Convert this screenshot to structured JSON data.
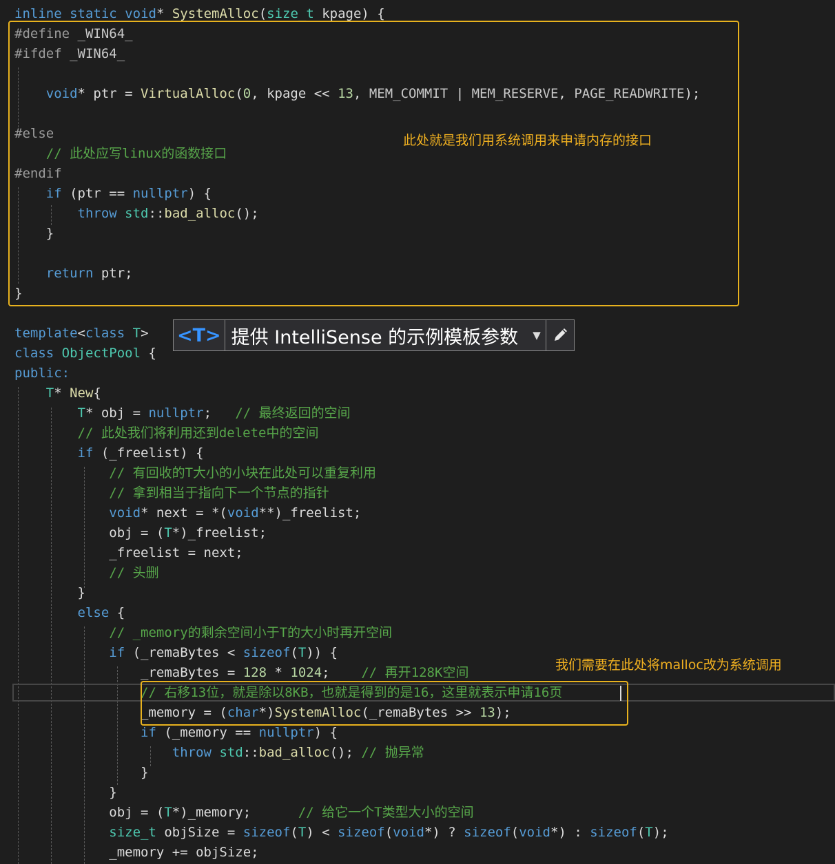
{
  "code": {
    "l1": "inline static void* SystemAlloc(size_t kpage) {",
    "l2": "#define _WIN64_",
    "l3": "#ifdef _WIN64_",
    "l4": "    void* ptr = VirtualAlloc(0, kpage << 13, MEM_COMMIT | MEM_RESERVE, PAGE_READWRITE);",
    "l5": "#else",
    "l6": "    // 此处应写linux的函数接口",
    "l7": "#endif",
    "l8": "    if (ptr == nullptr) {",
    "l9": "        throw std::bad_alloc();",
    "l10": "    }",
    "l11": "    return ptr;",
    "l12": "}",
    "l13": "template<class T>",
    "l14": "class ObjectPool {",
    "l15": "public:",
    "l16": "    T* New{",
    "l17": "        T* obj = nullptr;   // 最终返回的空间",
    "l18": "        // 此处我们将利用还到delete中的空间",
    "l19": "        if (_freelist) {",
    "l20": "            // 有回收的T大小的小块在此处可以重复利用",
    "l21": "            // 拿到相当于指向下一个节点的指针",
    "l22": "            void* next = *(void**)_freelist;",
    "l23": "            obj = (T*)_freelist;",
    "l24": "            _freelist = next;",
    "l25": "            // 头删",
    "l26": "        }",
    "l27": "        else {",
    "l28": "            // _memory的剩余空间小于T的大小时再开空间",
    "l29": "            if (_remaBytes < sizeof(T)) {",
    "l30": "                _remaBytes = 128 * 1024;    // 再开128K空间",
    "l31": "                // 右移13位，就是除以8KB，也就是得到的是16，这里就表示申请16页",
    "l32": "                _memory = (char*)SystemAlloc(_remaBytes >> 13);",
    "l33": "                if (_memory == nullptr) {",
    "l34": "                    throw std::bad_alloc(); // 抛异常",
    "l35": "                }",
    "l36": "            }",
    "l37": "            obj = (T*)_memory;      // 给它一个T类型大小的空间",
    "l38": "            size_t objSize = sizeof(T) < sizeof(void*) ? sizeof(void*) : sizeof(T);",
    "l39": "            _memory += objSize;"
  },
  "annotations": {
    "syscall_note": "此处就是我们用系统调用来申请内存的接口",
    "malloc_note": "我们需要在此处将malloc改为系统调用"
  },
  "tooltip": {
    "badge": "<T>",
    "text": "提供 IntelliSense 的示例模板参数",
    "chevron_icon": "chevron-down-icon",
    "edit_icon": "pencil-icon"
  },
  "colors": {
    "background": "#1e1e1e",
    "keyword": "#569cd6",
    "type": "#4ec9b0",
    "function": "#dcdcaa",
    "comment": "#57a64a",
    "macro": "#c8c8c8",
    "annotation": "#e8b21e"
  }
}
